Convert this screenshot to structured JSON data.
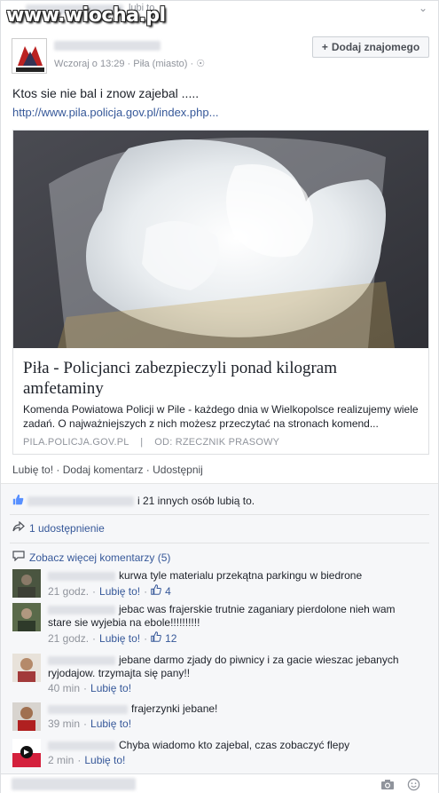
{
  "topbar": {
    "watermark": "www.wiocha.pl",
    "like_text": "lubi to."
  },
  "post": {
    "timestamp": "Wczoraj o 13:29",
    "location": "Piła (miasto)",
    "add_friend_label": "Dodaj znajomego",
    "text": "Ktos sie nie bal i znow zajebal .....",
    "link": "http://www.pila.policja.gov.pl/index.php..."
  },
  "link_card": {
    "title": "Piła - Policjanci zabezpieczyli ponad kilogram amfetaminy",
    "description": "Komenda Powiatowa Policji w Pile - każdego dnia w Wielkopolsce realizujemy wiele zadań. O najważniejszych z nich możesz przeczytać na stronach komend...",
    "source": "PILA.POLICJA.GOV.PL",
    "author": "OD: RZECZNIK PRASOWY"
  },
  "actions": {
    "like": "Lubię to!",
    "comment": "Dodaj komentarz",
    "share": "Udostępnij"
  },
  "likes_text": "i 21 innych osób lubią to.",
  "shares_text": "1 udostępnienie",
  "more_comments": "Zobacz więcej komentarzy (5)",
  "comments": [
    {
      "text": "kurwa tyle materialu przekątna parkingu w biedrone",
      "time": "21 godz.",
      "like": "Lubię to!",
      "likes": "4"
    },
    {
      "text": "jebac was frajerskie trutnie zaganiary pierdolone nieh wam stare sie wyjebia na ebole!!!!!!!!!!",
      "time": "21 godz.",
      "like": "Lubię to!",
      "likes": "12"
    },
    {
      "text": "jebane darmo zjady do piwnicy i za gacie wieszac jebanych ryjodajow. trzymajta się pany!!",
      "time": "40 min",
      "like": "Lubię to!",
      "likes": ""
    },
    {
      "text": "frajerzynki jebane!",
      "time": "39 min",
      "like": "Lubię to!",
      "likes": ""
    },
    {
      "text": "Chyba wiadomo kto zajebal, czas zobaczyć flepy",
      "time": "2 min",
      "like": "Lubię to!",
      "likes": ""
    }
  ],
  "colors": {
    "link": "#365899",
    "meta": "#90949c",
    "bg": "#f6f7f9"
  }
}
